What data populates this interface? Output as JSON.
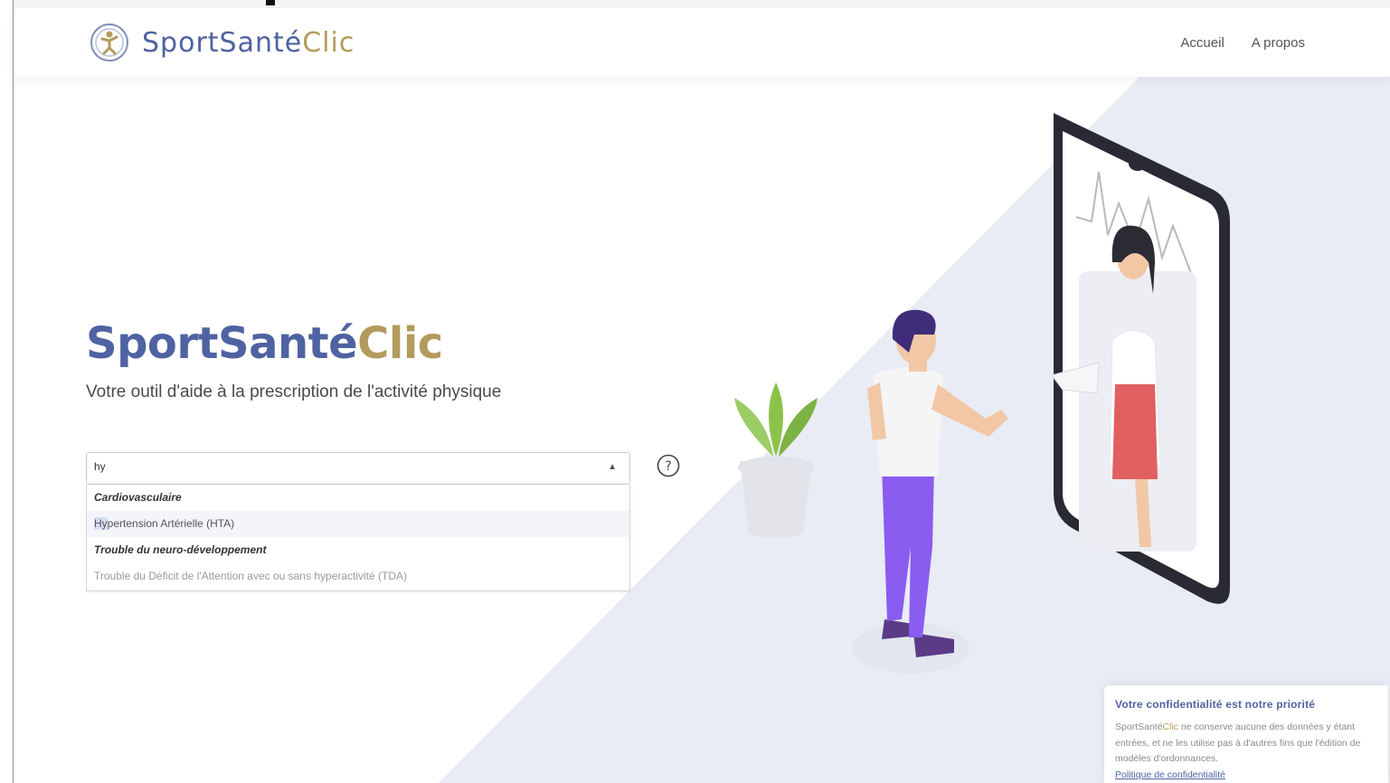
{
  "brand": {
    "name_part1": "SportSanté",
    "name_part2": "Clic"
  },
  "nav": {
    "home": "Accueil",
    "about": "A propos"
  },
  "hero": {
    "title_part1": "SportSanté",
    "title_part2": "Clic",
    "subtitle": "Votre outil d'aide à la prescription de l'activité physique"
  },
  "search": {
    "value": "hy",
    "options": [
      {
        "type": "group",
        "label": "Cardiovasculaire"
      },
      {
        "type": "option",
        "match": "Hy",
        "rest": "pertension Artérielle (HTA)"
      },
      {
        "type": "group",
        "label": "Trouble du neuro-développement"
      },
      {
        "type": "option",
        "label": "Trouble du Déficit de l'Attention avec ou sans hyperactivité (TDA)"
      }
    ]
  },
  "privacy": {
    "title": "Votre confidentialité est notre priorité",
    "brand_part1": "SportSanté",
    "brand_part2": "Clic",
    "text": " ne conserve aucune des données y étant entrées, et ne les utilise pas à d'autres fins que l'édition de modèles d'ordonnances.",
    "link": "Politique de confidentialité"
  },
  "colors": {
    "brand_blue": "#4f62a1",
    "brand_gold": "#b39b5d",
    "background_shape": "#e9ecf4",
    "plant_green": "#8bc34a",
    "pants_purple": "#8a5cf0",
    "skirt_red": "#e06060"
  }
}
